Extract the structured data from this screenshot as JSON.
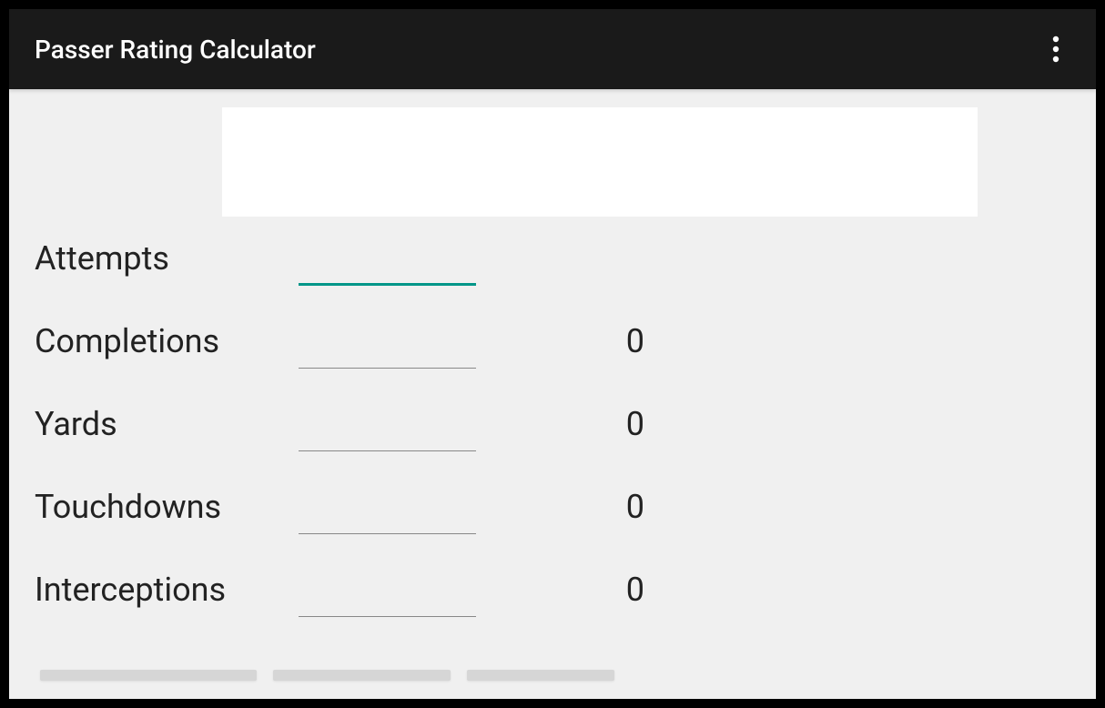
{
  "header": {
    "title": "Passer Rating Calculator"
  },
  "form": {
    "rows": [
      {
        "label": "Attempts",
        "value": "",
        "max": "",
        "focused": true
      },
      {
        "label": "Completions",
        "value": "",
        "max": "0",
        "focused": false
      },
      {
        "label": "Yards",
        "value": "",
        "max": "0",
        "focused": false
      },
      {
        "label": "Touchdowns",
        "value": "",
        "max": "0",
        "focused": false
      },
      {
        "label": "Interceptions",
        "value": "",
        "max": "0",
        "focused": false
      }
    ]
  },
  "colors": {
    "accent": "#009688",
    "appbar": "#1a1a1a"
  }
}
